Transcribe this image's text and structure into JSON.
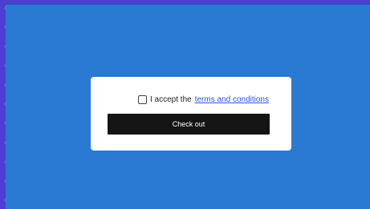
{
  "consent": {
    "prefix": "I accept the",
    "link_text": "terms and conditions",
    "checked": false
  },
  "actions": {
    "checkout_label": "Check out"
  },
  "colors": {
    "page_background": "#2a79d3",
    "card_background": "#ffffff",
    "button_background": "#141414",
    "link": "#2a55e0"
  }
}
